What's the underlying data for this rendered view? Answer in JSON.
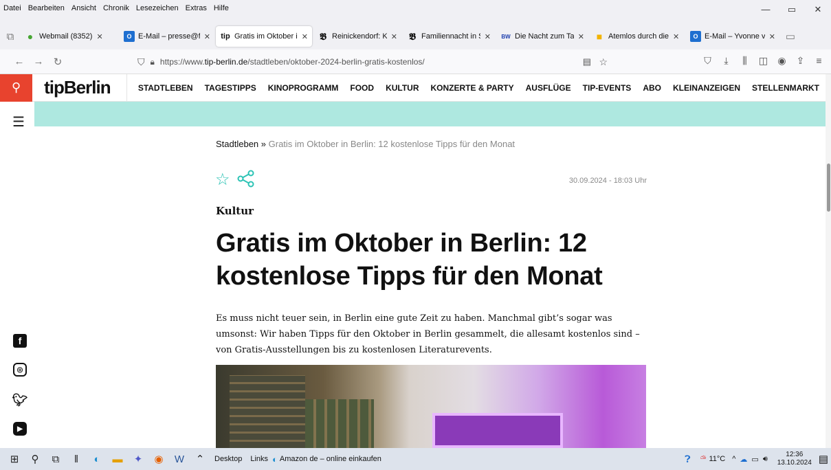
{
  "menubar": {
    "items": [
      "Datei",
      "Bearbeiten",
      "Ansicht",
      "Chronik",
      "Lesezeichen",
      "Extras",
      "Hilfe"
    ]
  },
  "window_controls": {
    "minimize": "—",
    "maximize": "▭",
    "close": "✕"
  },
  "tabs": [
    {
      "title": "Webmail (8352)",
      "fav": "●",
      "fav_color": "#46a532",
      "active": false
    },
    {
      "title": "E-Mail – presse@fa",
      "fav": "O",
      "fav_color": "#1e6fd0",
      "active": false
    },
    {
      "title": "Gratis im Oktober i",
      "fav": "tip",
      "fav_color": "#111111",
      "active": true
    },
    {
      "title": "Reinickendorf: Kost",
      "fav": "𝕭",
      "fav_color": "#111111",
      "active": false
    },
    {
      "title": "Familiennacht in St",
      "fav": "𝕭",
      "fav_color": "#111111",
      "active": false
    },
    {
      "title": "Die Nacht zum Tag",
      "fav": "BW",
      "fav_color": "#1e3fae",
      "active": false
    },
    {
      "title": "Atemlos durch die",
      "fav": "■",
      "fav_color": "#f2b300",
      "active": false
    },
    {
      "title": "E-Mail – Yvonne vo",
      "fav": "O",
      "fav_color": "#1e6fd0",
      "active": false
    }
  ],
  "url": {
    "prefix": "https://www.",
    "domain": "tip-berlin.de",
    "path": "/stadtleben/oktober-2024-berlin-gratis-kostenlos/"
  },
  "site": {
    "logo": "tipBerlin",
    "nav": [
      "STADTLEBEN",
      "TAGESTIPPS",
      "KINOPROGRAMM",
      "FOOD",
      "KULTUR",
      "KONZERTE & PARTY",
      "AUSFLÜGE",
      "TIP-EVENTS",
      "ABO",
      "KLEINANZEIGEN",
      "STELLENMARKT"
    ],
    "accent_color": "#2cc3b5",
    "band_color": "#aee8e0",
    "search_color": "#e8432e"
  },
  "article": {
    "breadcrumb_section": "Stadtleben",
    "breadcrumb_sep": " » ",
    "breadcrumb_current": "Gratis im Oktober in Berlin: 12 kostenlose Tipps für den Monat",
    "date": "30.09.2024 - 18:03 Uhr",
    "kicker": "Kultur",
    "headline": "Gratis im Oktober in Berlin: 12 kostenlose Tipps für den Monat",
    "lead": "Es muss nicht teuer sein, in Berlin eine gute Zeit zu haben. Manchmal gibt’s sogar was umsonst: Wir haben Tipps für den Oktober in Berlin gesammelt, die allesamt kostenlos sind – von Gratis-Ausstellungen bis zu kostenlosen Literaturevents."
  },
  "taskbar": {
    "desktop": "Desktop",
    "links": "Links",
    "amazon": "Amazon de – online einkaufen",
    "temperature": "11°C",
    "time": "12:36",
    "date": "13.10.2024"
  }
}
